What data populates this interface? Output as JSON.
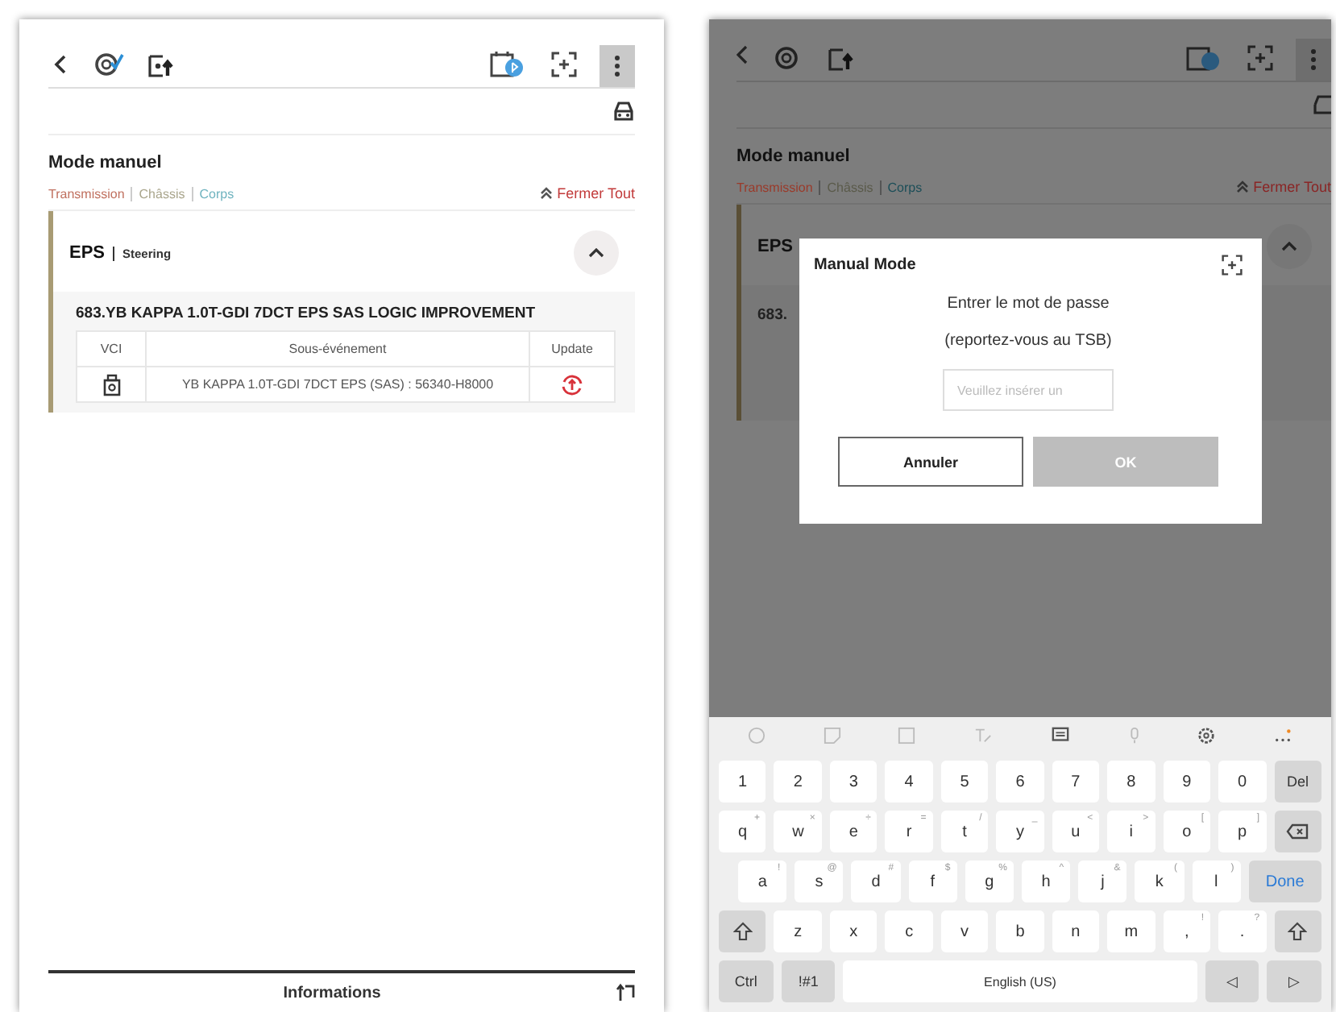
{
  "left_screen": {
    "title": "Mode manuel",
    "categories": [
      {
        "label": "Transmission",
        "color": "#c0705f"
      },
      {
        "label": "Châssis",
        "color": "#a9a58c"
      },
      {
        "label": "Corps",
        "color": "#6fb3bf"
      }
    ],
    "close_all": "Fermer Tout",
    "section": {
      "name": "EPS",
      "subtitle": "Steering",
      "expanded": true,
      "event_title": "683.YB KAPPA 1.0T-GDI 7DCT EPS SAS LOGIC IMPROVEMENT",
      "columns": [
        "VCI",
        "Sous-événement",
        "Update"
      ],
      "rows": [
        {
          "sub_event": "YB KAPPA 1.0T-GDI 7DCT EPS (SAS) : 56340-H8000"
        }
      ]
    },
    "footer": "Informations"
  },
  "right_screen": {
    "title": "Mode manuel",
    "categories": [
      {
        "label": "Transmission",
        "color": "#9a3a2a"
      },
      {
        "label": "Châssis",
        "color": "#5a5a4a"
      },
      {
        "label": "Corps",
        "color": "#1c4e58"
      }
    ],
    "close_all": "Fermer Tout",
    "section_name": "EPS",
    "event_title_fragment": "683.",
    "dialog": {
      "title": "Manual Mode",
      "message": "Entrer le mot de passe",
      "note": "(reportez-vous au TSB)",
      "password": {
        "placeholder": "Veuillez insérer un"
      },
      "buttons": [
        {
          "label": "Annuler",
          "disabled": false
        },
        {
          "label": "OK",
          "disabled": true
        }
      ]
    },
    "keyboard": {
      "rows": [
        {
          "keys": [
            {
              "label": "1",
              "kind": "char"
            },
            {
              "label": "2",
              "kind": "char"
            },
            {
              "label": "3",
              "kind": "char"
            },
            {
              "label": "4",
              "kind": "char"
            },
            {
              "label": "5",
              "kind": "char"
            },
            {
              "label": "6",
              "kind": "char"
            },
            {
              "label": "7",
              "kind": "char"
            },
            {
              "label": "8",
              "kind": "char"
            },
            {
              "label": "9",
              "kind": "char"
            },
            {
              "label": "0",
              "kind": "char"
            },
            {
              "label": "Del",
              "kind": "mod"
            }
          ]
        },
        {
          "keys": [
            {
              "label": "q",
              "hint": "+",
              "kind": "char"
            },
            {
              "label": "w",
              "hint": "×",
              "kind": "char"
            },
            {
              "label": "e",
              "hint": "÷",
              "kind": "char"
            },
            {
              "label": "r",
              "hint": "=",
              "kind": "char"
            },
            {
              "label": "t",
              "hint": "/",
              "kind": "char"
            },
            {
              "label": "y",
              "hint": "_",
              "kind": "char"
            },
            {
              "label": "u",
              "hint": "<",
              "kind": "char"
            },
            {
              "label": "i",
              "hint": ">",
              "kind": "char"
            },
            {
              "label": "o",
              "hint": "[",
              "kind": "char"
            },
            {
              "label": "p",
              "hint": "]",
              "kind": "char"
            },
            {
              "kind": "backspace"
            }
          ]
        },
        {
          "keys": [
            {
              "label": "a",
              "hint": "!",
              "kind": "char"
            },
            {
              "label": "s",
              "hint": "@",
              "kind": "char"
            },
            {
              "label": "d",
              "hint": "#",
              "kind": "char"
            },
            {
              "label": "f",
              "hint": "$",
              "kind": "char"
            },
            {
              "label": "g",
              "hint": "%",
              "kind": "char"
            },
            {
              "label": "h",
              "hint": "^",
              "kind": "char"
            },
            {
              "label": "j",
              "hint": "&",
              "kind": "char"
            },
            {
              "label": "k",
              "hint": "(",
              "kind": "char"
            },
            {
              "label": "l",
              "hint": ")",
              "kind": "char"
            },
            {
              "label": "Done",
              "kind": "done"
            }
          ]
        },
        {
          "keys": [
            {
              "kind": "shift"
            },
            {
              "label": "z",
              "kind": "char"
            },
            {
              "label": "x",
              "kind": "char"
            },
            {
              "label": "c",
              "kind": "char"
            },
            {
              "label": "v",
              "kind": "char"
            },
            {
              "label": "b",
              "kind": "char"
            },
            {
              "label": "n",
              "kind": "char"
            },
            {
              "label": "m",
              "kind": "char"
            },
            {
              "label": ",",
              "hint": "!",
              "kind": "char"
            },
            {
              "label": ".",
              "hint": "?",
              "kind": "char"
            },
            {
              "kind": "shift"
            }
          ]
        },
        {
          "keys": [
            {
              "label": "Ctrl",
              "kind": "mod"
            },
            {
              "label": "!#1",
              "kind": "mod"
            },
            {
              "label": "English (US)",
              "kind": "space"
            },
            {
              "label": "◁",
              "kind": "mod"
            },
            {
              "label": "▷",
              "kind": "mod"
            }
          ]
        }
      ]
    }
  }
}
